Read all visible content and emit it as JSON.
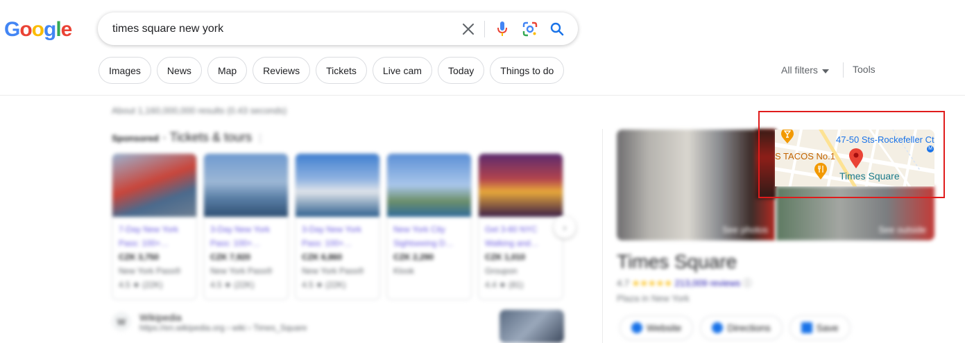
{
  "header": {
    "logo_text": "Google",
    "search": {
      "value": "times square new york",
      "clear_icon": "close-icon",
      "voice_icon": "mic-icon",
      "lens_icon": "lens-icon",
      "search_icon": "search-icon"
    }
  },
  "chips": [
    "Images",
    "News",
    "Map",
    "Reviews",
    "Tickets",
    "Live cam",
    "Today",
    "Things to do"
  ],
  "filters": {
    "all_filters": "All filters",
    "tools": "Tools"
  },
  "results": {
    "stats": "About 1,160,000,000 results (0.43 seconds)",
    "sponsored_label": "Sponsored",
    "sponsored_title": "Tickets & tours",
    "cards": [
      {
        "title": "7-Day New York Pass: 100+…",
        "price": "CZK 3,750",
        "source": "New York Pass®",
        "rating": "4.5 ★ (22K)"
      },
      {
        "title": "3-Day New York Pass: 100+…",
        "price": "CZK 7,920",
        "source": "New York Pass®",
        "rating": "4.5 ★ (22K)"
      },
      {
        "title": "3-Day New York Pass: 100+…",
        "price": "CZK 6,860",
        "source": "New York Pass®",
        "rating": "4.5 ★ (22K)"
      },
      {
        "title": "New York City Sightseeing D…",
        "price": "CZK 2,290",
        "source": "Klook",
        "rating": ""
      },
      {
        "title": "Get 3-60 NYC Walking and…",
        "price": "CZK 1,010",
        "source": "Groupon",
        "rating": "4.4 ★ (81)"
      }
    ],
    "wiki": {
      "name": "Wikipedia",
      "url": "https://en.wikipedia.org › wiki › Times_Square"
    }
  },
  "knowledge_panel": {
    "photo_label": "See photos",
    "street_label": "See outside",
    "title": "Times Square",
    "rating_value": "4.7",
    "stars": "★★★★★",
    "reviews": "213,009 reviews",
    "type": "Plaza in New York",
    "actions": [
      "Website",
      "Directions",
      "Save"
    ],
    "map": {
      "label_rockefeller": "47-50 Sts-Rockefeller Ctr",
      "label_tacos": "S TACOS No.1",
      "label_times_square": "Times Square"
    }
  },
  "colors": {
    "accent_blue": "#1a73e8",
    "highlight_red": "#e01b1b",
    "map_pin": "#ea4335"
  }
}
